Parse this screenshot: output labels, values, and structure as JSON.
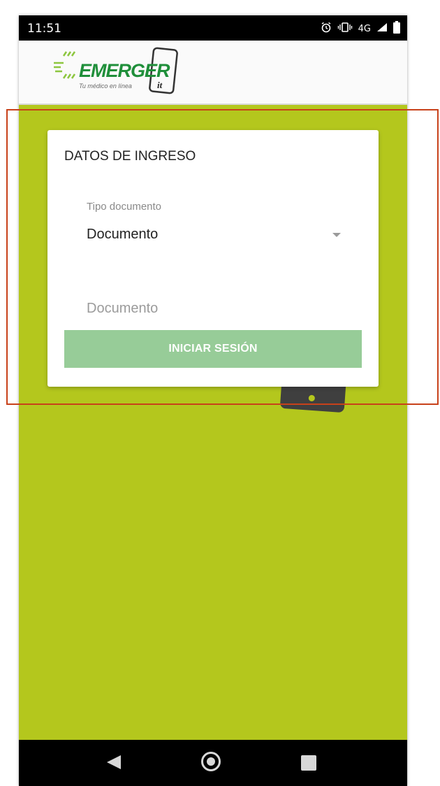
{
  "status_bar": {
    "time": "11:51",
    "network": "4G"
  },
  "header": {
    "brand": "EMERGER",
    "brand_badge": "it",
    "tagline": "Tu médico en línea"
  },
  "login_card": {
    "title": "DATOS DE INGRESO",
    "doc_type_label": "Tipo documento",
    "doc_type_value": "Documento",
    "document_placeholder": "Documento",
    "submit_label": "INICIAR SESIÓN"
  },
  "nav_bar": {
    "icons": [
      "back-icon",
      "home-icon",
      "recents-icon"
    ]
  },
  "colors": {
    "background": "#b4c71d",
    "button": "#97cc98",
    "brand_green": "#1f8f3a",
    "highlight": "#c8411a"
  }
}
